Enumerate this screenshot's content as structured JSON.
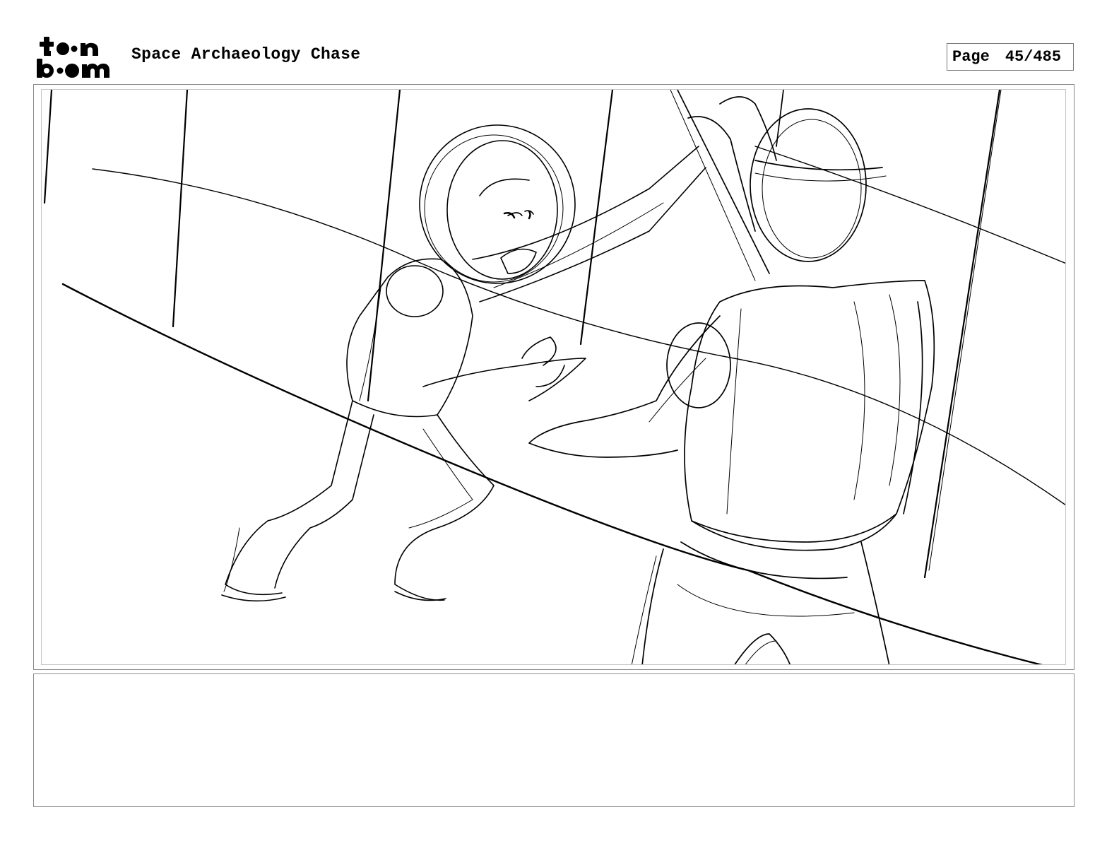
{
  "header": {
    "logo_text_top": "toon",
    "logo_text_bottom": "boom",
    "project_title": "Space Archaeology Chase",
    "page_label": "Page",
    "page_number": "45/485"
  },
  "panel": {
    "image_name": "storyboard-sketch"
  },
  "notes": {
    "text": ""
  }
}
